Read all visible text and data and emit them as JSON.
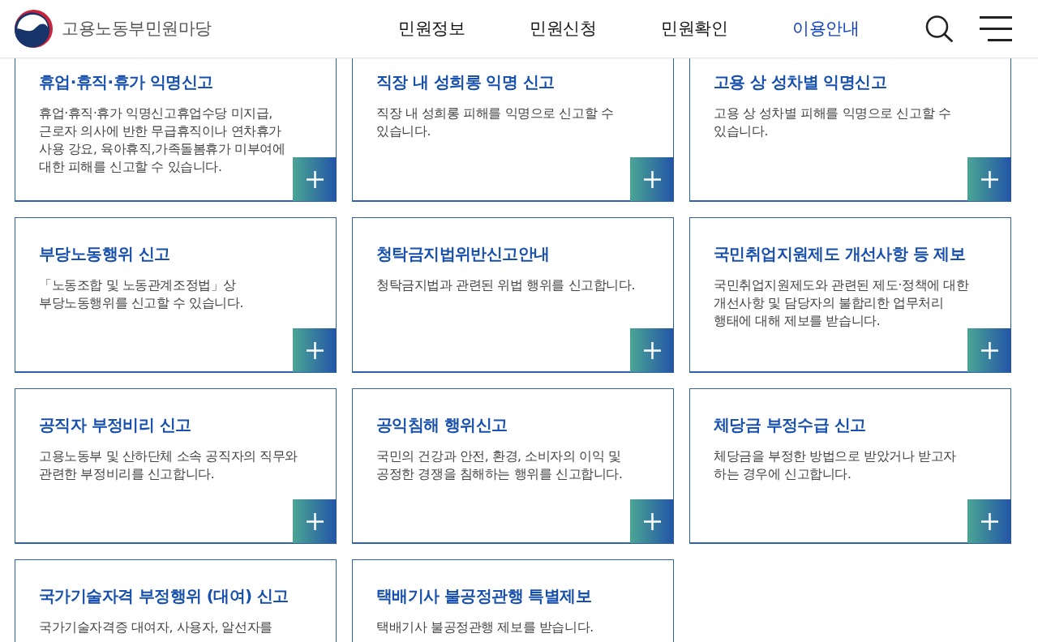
{
  "header": {
    "logo_text": "고용노동부민원마당",
    "nav": [
      {
        "label": "민원정보",
        "selected": false
      },
      {
        "label": "민원신청",
        "selected": false
      },
      {
        "label": "민원확인",
        "selected": false
      },
      {
        "label": "이용안내",
        "selected": true
      }
    ]
  },
  "cards": [
    {
      "title": "휴업·휴직·휴가 익명신고",
      "description_lines": [
        "휴업·휴직·휴가 익명신고휴업수당 미지급,",
        "근로자 의사에 반한 무급휴직이나 연차휴가",
        "사용 강요, 육아휴직,가족돌봄휴가 미부여에",
        "대한 피해를 신고할 수 있습니다."
      ]
    },
    {
      "title": "직장 내 성희롱 익명 신고",
      "description_lines": [
        "직장 내 성희롱 피해를 익명으로 신고할 수",
        "있습니다."
      ]
    },
    {
      "title": "고용 상 성차별 익명신고",
      "description_lines": [
        "고용 상 성차별 피해를 익명으로 신고할 수",
        "있습니다."
      ]
    },
    {
      "title": "부당노동행위 신고",
      "description_lines": [
        "「노동조합 및 노동관계조정법」상",
        "부당노동행위를 신고할 수 있습니다."
      ]
    },
    {
      "title": "청탁금지법위반신고안내",
      "description_lines": [
        "청탁금지법과 관련된 위법 행위를 신고합니다."
      ]
    },
    {
      "title": "국민취업지원제도 개선사항 등 제보",
      "description_lines": [
        "국민취업지원제도와 관련된 제도·정책에 대한",
        "개선사항 및 담당자의 불합리한 업무처리",
        "행태에 대해 제보를 받습니다."
      ]
    },
    {
      "title": "공직자 부정비리 신고",
      "description_lines": [
        "고용노동부 및 산하단체 소속 공직자의 직무와",
        "관련한 부정비리를 신고합니다."
      ]
    },
    {
      "title": "공익침해 행위신고",
      "description_lines": [
        "국민의 건강과 안전, 환경, 소비자의 이익 및",
        "공정한 경쟁을 침해하는 행위를 신고합니다."
      ]
    },
    {
      "title": "체당금 부정수급 신고",
      "description_lines": [
        "체당금을 부정한 방법으로 받았거나 받고자",
        "하는 경우에 신고합니다."
      ]
    },
    {
      "title": "국가기술자격 부정행위 (대여) 신고",
      "description_lines": [
        "국가기술자격증 대여자, 사용자, 알선자를"
      ]
    },
    {
      "title": "택배기사 불공정관행 특별제보",
      "description_lines": [
        "택배기사 불공정관행 제보를 받습니다."
      ]
    }
  ]
}
